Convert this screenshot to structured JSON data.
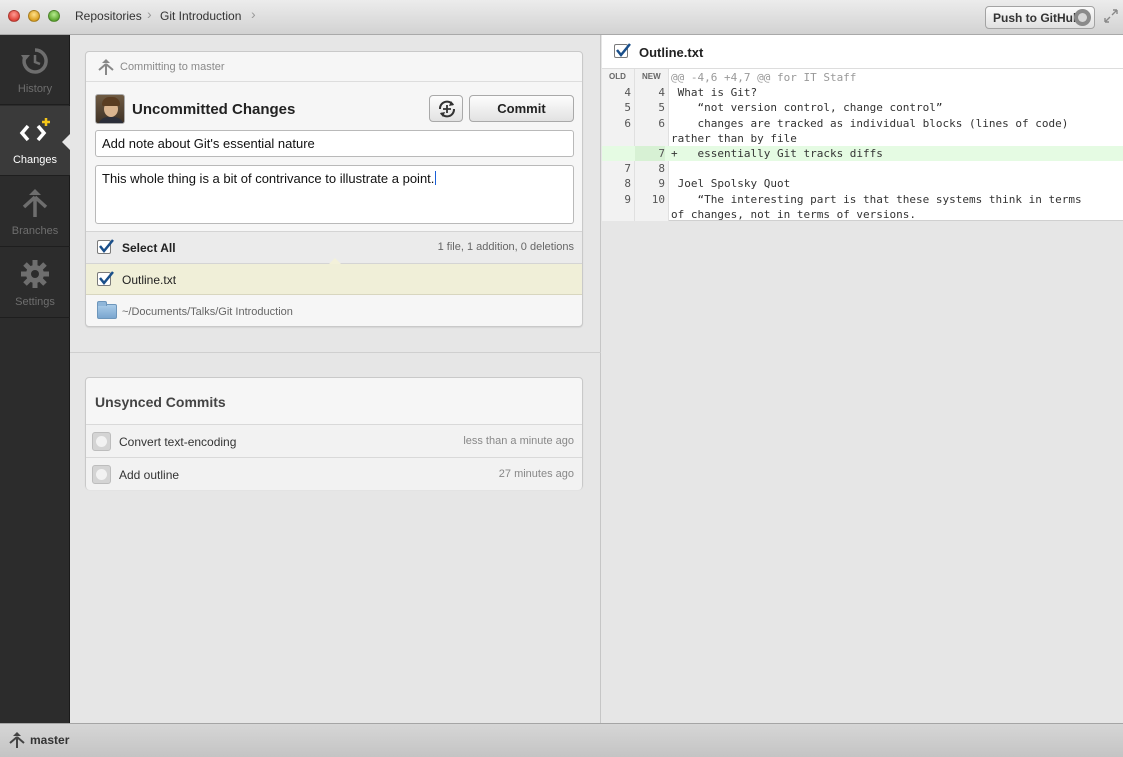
{
  "titlebar": {
    "breadcrumbs": [
      "Repositories",
      "Git Introduction"
    ],
    "push_label": "Push to GitHub"
  },
  "sidebar": {
    "items": [
      {
        "label": "History",
        "icon": "history-icon"
      },
      {
        "label": "Changes",
        "icon": "changes-icon",
        "active": true
      },
      {
        "label": "Branches",
        "icon": "branches-icon"
      },
      {
        "label": "Settings",
        "icon": "gear-icon"
      }
    ]
  },
  "commit": {
    "header": "Committing to master",
    "title": "Uncommitted Changes",
    "commit_label": "Commit",
    "summary": "Add note about Git's essential nature",
    "description": "This whole thing is a bit of contrivance to illustrate a point.",
    "select_all_label": "Select All",
    "stats": "1 file, 1 addition, 0 deletions",
    "file": "Outline.txt",
    "path": "~/Documents/Talks/Git Introduction"
  },
  "unsynced": {
    "title": "Unsynced Commits",
    "commits": [
      {
        "message": "Convert text-encoding",
        "time": "less than a minute ago"
      },
      {
        "message": "Add outline",
        "time": "27 minutes ago"
      }
    ]
  },
  "diff": {
    "filename": "Outline.txt",
    "old_header": "OLD",
    "new_header": "NEW",
    "lines": [
      {
        "old": "",
        "new": "",
        "text": "@@ -4,6 +4,7 @@ for IT Staff",
        "type": "hunk"
      },
      {
        "old": "4",
        "new": "4",
        "text": " What is Git?",
        "type": "context"
      },
      {
        "old": "5",
        "new": "5",
        "text": "    “not version control, change control”",
        "type": "context"
      },
      {
        "old": "6",
        "new": "6",
        "text": "    changes are tracked as individual blocks (lines of code)",
        "type": "context"
      },
      {
        "old": "",
        "new": "",
        "text": "rather than by file",
        "type": "context"
      },
      {
        "old": "",
        "new": "7",
        "text": "+   essentially Git tracks diffs",
        "type": "added"
      },
      {
        "old": "7",
        "new": "8",
        "text": "",
        "type": "context"
      },
      {
        "old": "8",
        "new": "9",
        "text": " Joel Spolsky Quot",
        "type": "context"
      },
      {
        "old": "9",
        "new": "10",
        "text": "    “The interesting part is that these systems think in terms",
        "type": "context"
      },
      {
        "old": "",
        "new": "",
        "text": "of changes, not in terms of versions.",
        "type": "context"
      }
    ]
  },
  "status": {
    "branch": "master"
  },
  "colors": {
    "sidebar_bg": "#2c2c2c",
    "added_line_bg": "#e5fbe3",
    "selected_file_bg": "#f0efd8",
    "accent_blue": "#1a4f8a"
  }
}
